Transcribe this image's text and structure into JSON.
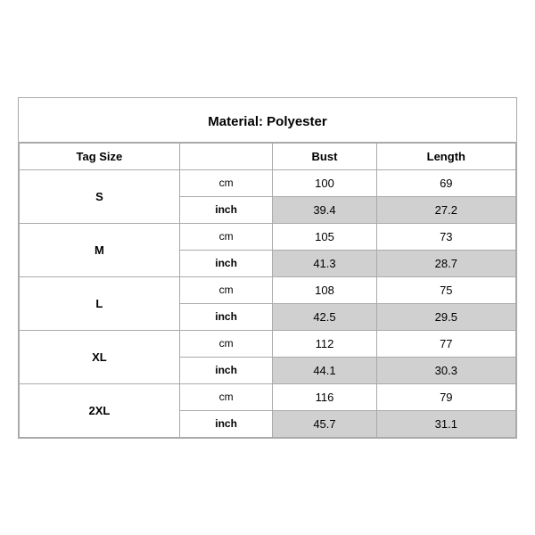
{
  "title": "Material: Polyester",
  "headers": {
    "tag_size": "Tag Size",
    "bust": "Bust",
    "length": "Length"
  },
  "sizes": [
    {
      "tag": "S",
      "cm": {
        "bust": "100",
        "length": "69"
      },
      "inch": {
        "bust": "39.4",
        "length": "27.2"
      }
    },
    {
      "tag": "M",
      "cm": {
        "bust": "105",
        "length": "73"
      },
      "inch": {
        "bust": "41.3",
        "length": "28.7"
      }
    },
    {
      "tag": "L",
      "cm": {
        "bust": "108",
        "length": "75"
      },
      "inch": {
        "bust": "42.5",
        "length": "29.5"
      }
    },
    {
      "tag": "XL",
      "cm": {
        "bust": "112",
        "length": "77"
      },
      "inch": {
        "bust": "44.1",
        "length": "30.3"
      }
    },
    {
      "tag": "2XL",
      "cm": {
        "bust": "116",
        "length": "79"
      },
      "inch": {
        "bust": "45.7",
        "length": "31.1"
      }
    }
  ],
  "units": {
    "cm": "cm",
    "inch": "inch"
  }
}
